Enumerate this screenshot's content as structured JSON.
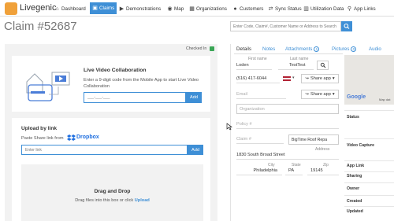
{
  "app": {
    "name": "Livegenic"
  },
  "nav": [
    {
      "label": "Dashboard",
      "icon": "home-icon",
      "glyph": "⌂",
      "active": false
    },
    {
      "label": "Claims",
      "icon": "claims-icon",
      "glyph": "▣",
      "active": true
    },
    {
      "label": "Demonstrations",
      "icon": "demonstrations-icon",
      "glyph": "▶",
      "active": false
    },
    {
      "label": "Map",
      "icon": "globe-icon",
      "glyph": "◉",
      "active": false
    },
    {
      "label": "Organizations",
      "icon": "organizations-icon",
      "glyph": "▦",
      "active": false
    },
    {
      "label": "Customers",
      "icon": "customers-icon",
      "glyph": "●",
      "active": false
    },
    {
      "label": "Sync Status",
      "icon": "sync-icon",
      "glyph": "⇄",
      "active": false
    },
    {
      "label": "Utilization Data",
      "icon": "chart-icon",
      "glyph": "▥",
      "active": false
    },
    {
      "label": "App Links",
      "icon": "link-icon",
      "glyph": "⚲",
      "active": false
    }
  ],
  "header": {
    "title": "Claim #52687",
    "search_placeholder": "Enter Code, Claim#, Customer Name or Address to Search"
  },
  "left": {
    "checked_in": "Checked In",
    "live_video": {
      "title": "Live Video Collaboration",
      "description": "Enter a 9-digit code from the Mobile App to start Live Video Collaboration",
      "code_placeholder": "___-___-___",
      "add_label": "Add"
    },
    "upload": {
      "title": "Upload by link",
      "paste_text": "Paste Share link from",
      "dropbox": "Dropbox",
      "link_placeholder": "Enter link",
      "add_label": "Add"
    },
    "dropzone": {
      "title": "Drag and Drop",
      "description": "Drag files into this box or click",
      "upload_link": "Upload"
    }
  },
  "tabs": [
    {
      "label": "Details",
      "count": "",
      "active": true
    },
    {
      "label": "Notes",
      "count": "",
      "active": false
    },
    {
      "label": "Attachments",
      "count": "1",
      "active": false
    },
    {
      "label": "Pictures",
      "count": "0",
      "active": false
    },
    {
      "label": "Audio",
      "count": "",
      "active": false
    }
  ],
  "details": {
    "first_name_label": "First name",
    "first_name": "Loden",
    "last_name_label": "Last name",
    "last_name": "TestTest",
    "phone": "(516) 417-6044",
    "flag": "US",
    "share_app": "Share app",
    "email_placeholder": "Email",
    "organization_placeholder": "Organization",
    "policy_placeholder": "Policy #",
    "claim_placeholder": "Claim #",
    "claim_type": "BigTime Roof Repa",
    "address_label": "Address",
    "address": "1830 South Broad Street",
    "city_label": "City",
    "city": "Philadelphia",
    "state_label": "State",
    "state": "PA",
    "zip_label": "Zip",
    "zip": "19145"
  },
  "side": {
    "map_logo": "Google",
    "map_data": "Map dat",
    "labels": [
      "Status",
      "Video Capture",
      "App Link",
      "Sharing",
      "Owner",
      "Created",
      "Updated"
    ]
  }
}
